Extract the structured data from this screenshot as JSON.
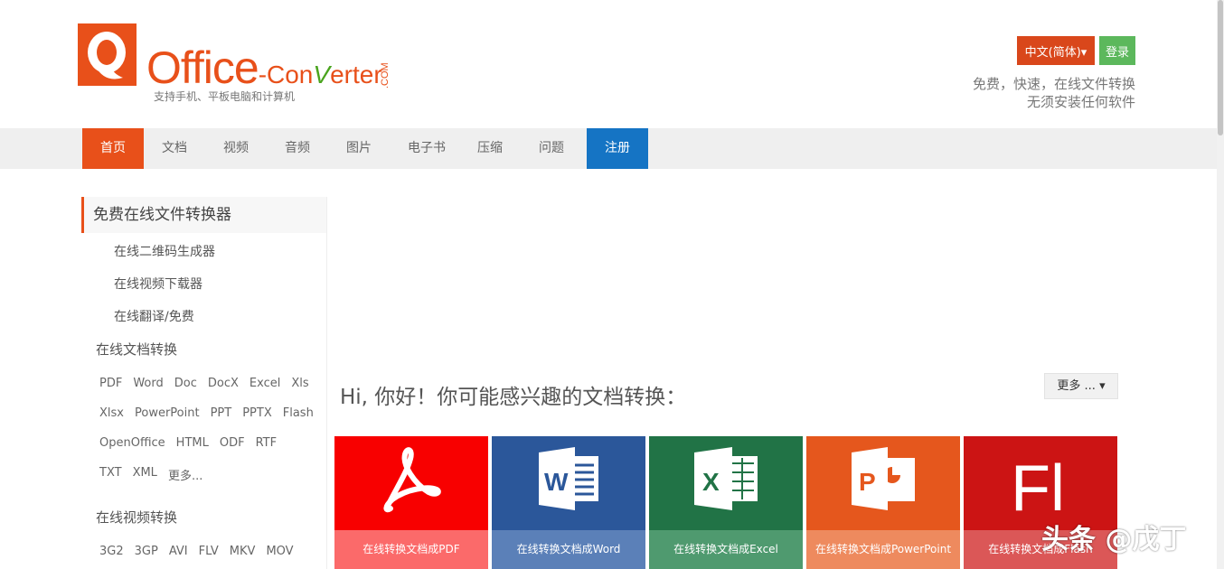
{
  "header": {
    "logo_main": "Office",
    "logo_dash": "-",
    "logo_con": "Con",
    "logo_v": "V",
    "logo_erter": "erter",
    "logo_com": ".COM",
    "logo_sub": "支持手机、平板电脑和计算机",
    "lang_label": "中文(简体)▾",
    "login_label": "登录",
    "tagline1": "免费，快速，在线文件转换",
    "tagline2": "无须安装任何软件"
  },
  "nav": {
    "items": [
      "首页",
      "文档",
      "视频",
      "音频",
      "图片",
      "电子书",
      "压缩",
      "问题",
      "注册"
    ]
  },
  "sidebar": {
    "heading": "免费在线文件转换器",
    "links": [
      "在线二维码生成器",
      "在线视频下载器",
      "在线翻译/免费"
    ],
    "doc_category": "在线文档转换",
    "doc_formats": [
      [
        "PDF",
        "Word",
        "Doc",
        "DocX",
        "Excel",
        "Xls"
      ],
      [
        "Xlsx",
        "PowerPoint",
        "PPT",
        "PPTX",
        "Flash"
      ],
      [
        "OpenOffice",
        "HTML",
        "ODF",
        "RTF"
      ],
      [
        "TXT",
        "XML",
        "更多..."
      ]
    ],
    "video_category": "在线视频转换",
    "video_formats": [
      "3G2",
      "3GP",
      "AVI",
      "FLV",
      "MKV",
      "MOV"
    ]
  },
  "main": {
    "greeting": "Hi, 你好！你可能感兴趣的文档转换：",
    "more_label": "更多 ... ▾",
    "tiles": [
      {
        "label": "在线转换文档成PDF",
        "icon": "pdf-icon",
        "bg": "#f80000",
        "band": "#fb6a6a"
      },
      {
        "label": "在线转换文档成Word",
        "icon": "word-icon",
        "bg": "#2b579a",
        "band": "#5b80b8"
      },
      {
        "label": "在线转换文档成Excel",
        "icon": "excel-icon",
        "bg": "#217346",
        "band": "#4f9a6f"
      },
      {
        "label": "在线转换文档成PowerPoint",
        "icon": "powerpoint-icon",
        "bg": "#e5571d",
        "band": "#ee8a5e"
      },
      {
        "label": "在线转换文档成Flash",
        "icon": "flash-icon",
        "bg": "#cc1414",
        "band": "#db5757"
      }
    ],
    "flash_glyph": "Fl"
  },
  "watermark": "头条 @戊丁",
  "colors": {
    "brand": "#e8501a",
    "register": "#1574c4",
    "login": "#5cb85c"
  }
}
